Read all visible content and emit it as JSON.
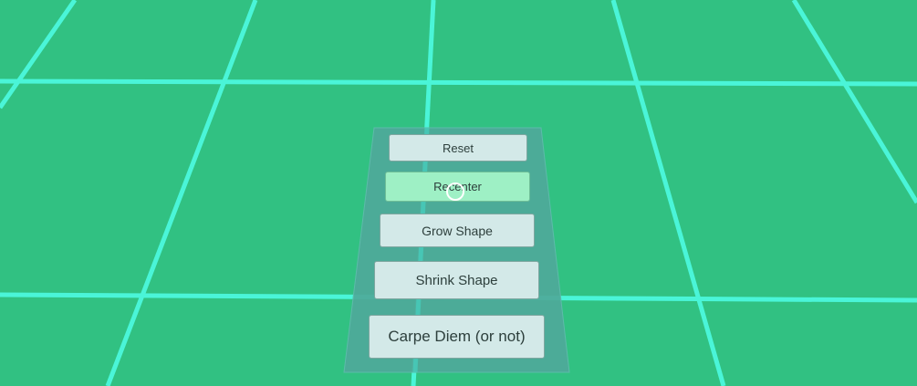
{
  "scene": {
    "floor_color": "#31c182",
    "grid_line_color": "#4af5d8",
    "panel_color": "#4ea99a"
  },
  "menu": {
    "buttons": [
      {
        "label": "Reset"
      },
      {
        "label": "Recenter",
        "state": "hovered"
      },
      {
        "label": "Grow Shape"
      },
      {
        "label": "Shrink Shape"
      },
      {
        "label": "Carpe Diem (or not)"
      }
    ]
  },
  "cursor": {
    "icon": "ring-cursor-icon"
  }
}
